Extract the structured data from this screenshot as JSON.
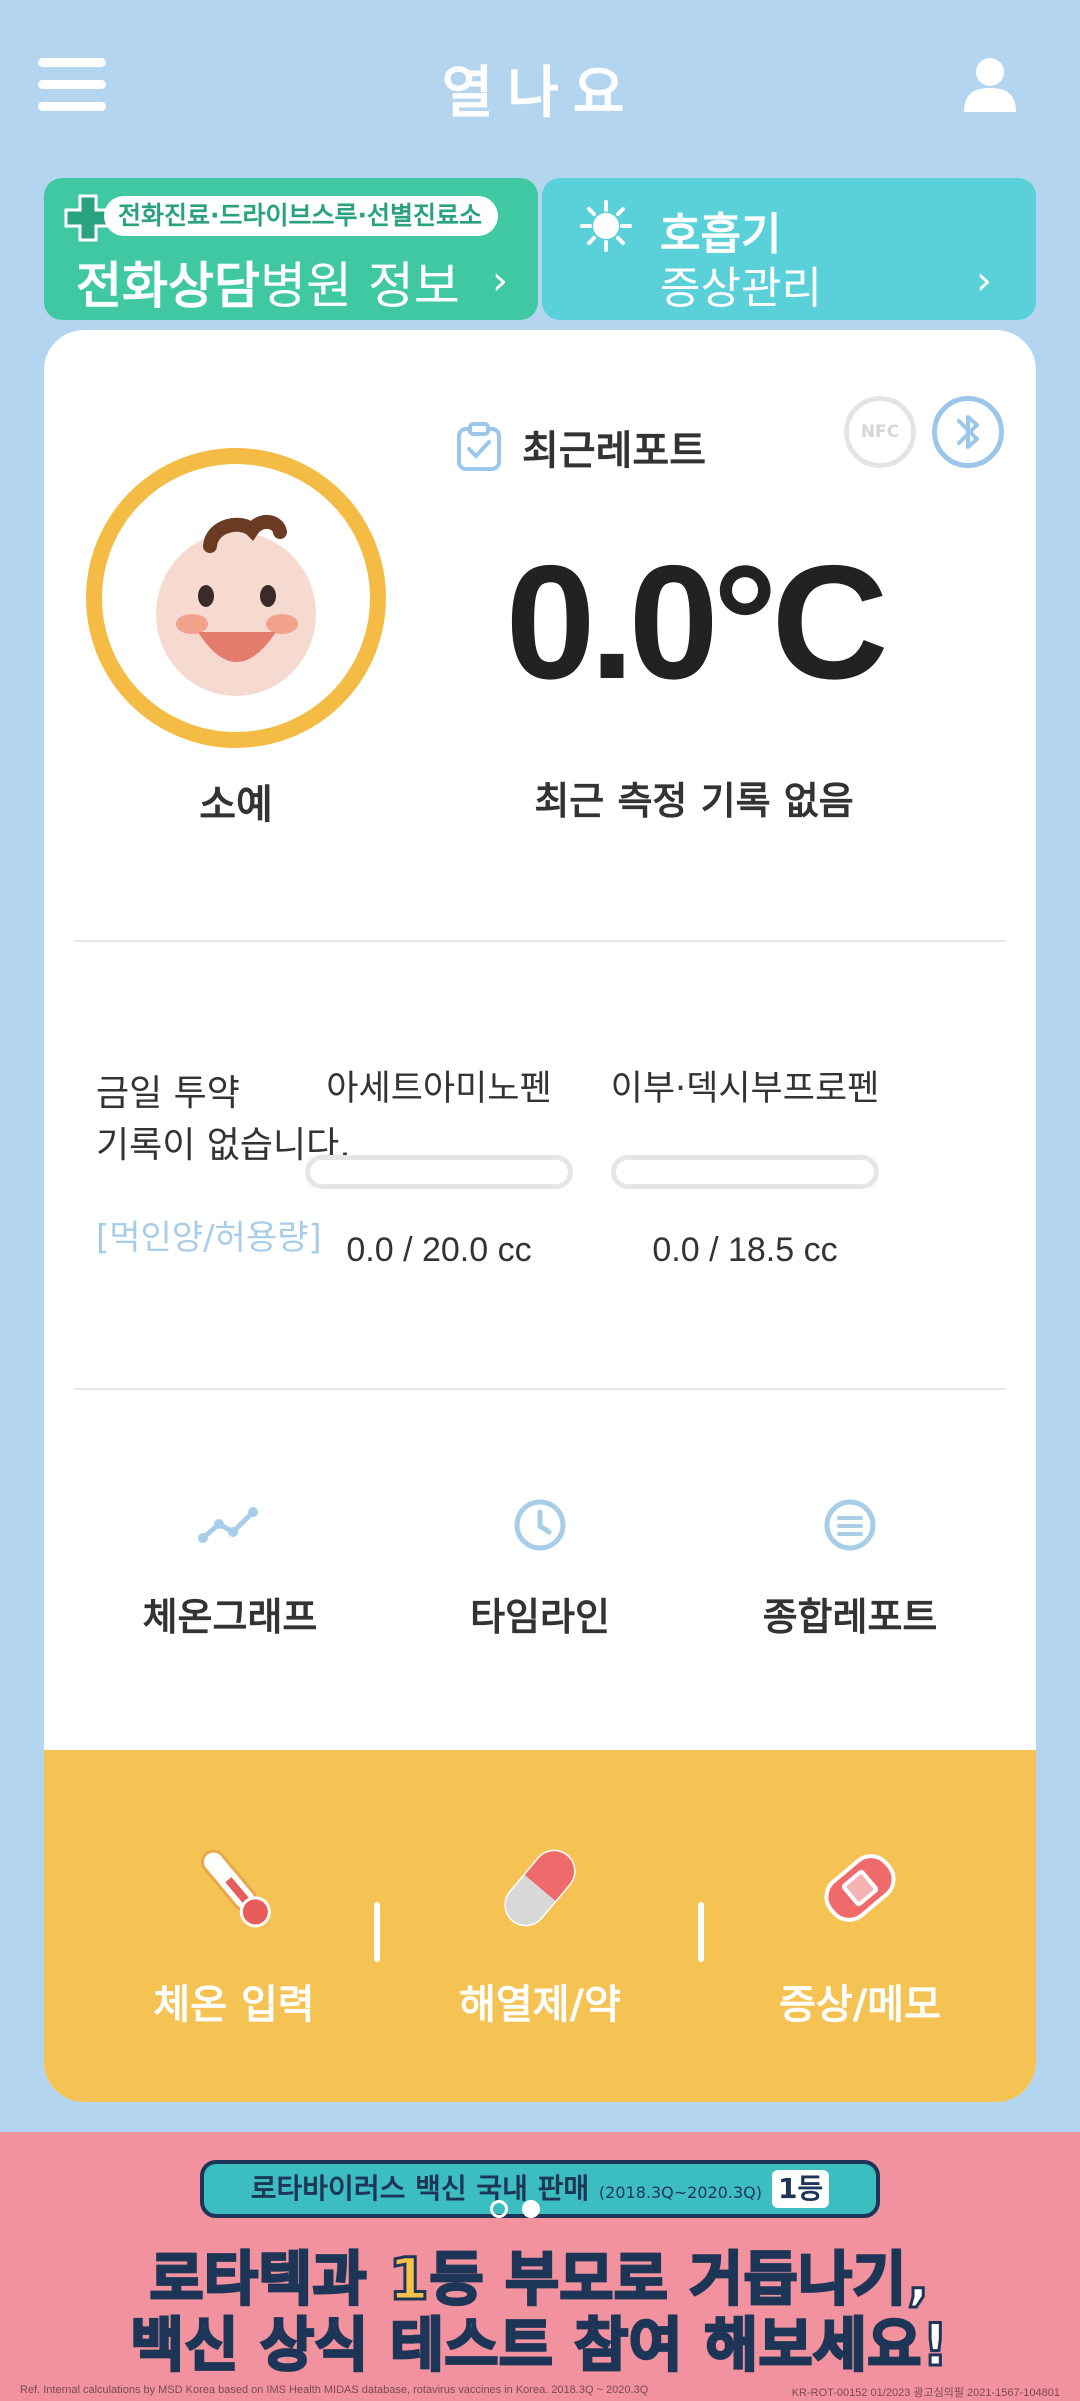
{
  "header": {
    "title": "열나요",
    "menu_icon": "hamburger-menu-icon",
    "profile_icon": "user-profile-icon"
  },
  "banners": {
    "left": {
      "pill": "전화진료·드라이브스루·선별진료소",
      "title_bold": "전화상담",
      "title_light": "병원 정보",
      "chevron": "›"
    },
    "right": {
      "title": "호흡기",
      "subtitle": "증상관리",
      "chevron": "›"
    }
  },
  "card": {
    "recent_report": "최근레포트",
    "nfc": "NFC",
    "child_name": "소예",
    "temperature": "0.0°C",
    "no_record": "최근 측정 기록 없음",
    "medication": {
      "info_line1": "금일 투약",
      "info_line2": "기록이 없습니다.",
      "dose_link": "[먹인양/허용량]",
      "meds": [
        {
          "name": "아세트아미노펜",
          "amount": "0.0 / 20.0 cc",
          "progress": 0
        },
        {
          "name": "이부·덱시부프로펜",
          "amount": "0.0 / 18.5 cc",
          "progress": 0
        }
      ]
    },
    "quick_links": [
      {
        "label": "체온그래프",
        "icon": "graph-icon"
      },
      {
        "label": "타임라인",
        "icon": "clock-icon"
      },
      {
        "label": "종합레포트",
        "icon": "report-list-icon"
      }
    ],
    "actions": [
      {
        "label": "체온 입력",
        "icon": "thermometer-icon"
      },
      {
        "label": "해열제/약",
        "icon": "pill-icon"
      },
      {
        "label": "증상/메모",
        "icon": "bandage-icon"
      }
    ]
  },
  "ad": {
    "pill_main": "로타바이러스 백신 국내 판매",
    "pill_small": "(2018.3Q~2020.3Q)",
    "pill_badge": "1등",
    "line1_a": "로타텍과 ",
    "line1_b": "1등",
    "line1_c": " 부모로 거듭나기,",
    "line2_a": "백신 상식 ",
    "line2_b": "테스트",
    "line2_c": " 참여 해보세요!",
    "footnote_left": "Ref. Internal calculations by MSD Korea based on IMS Health MIDAS database, rotavirus vaccines in Korea. 2018.3Q ~ 2020.3Q",
    "footnote_right": "KR-ROT-00152 01/2023 광고심의필 2021-1567-104801"
  },
  "colors": {
    "background": "#b3d5ef",
    "green": "#40c8a3",
    "teal": "#5ad0d8",
    "yellow": "#f5c254",
    "pink": "#f1929e"
  }
}
